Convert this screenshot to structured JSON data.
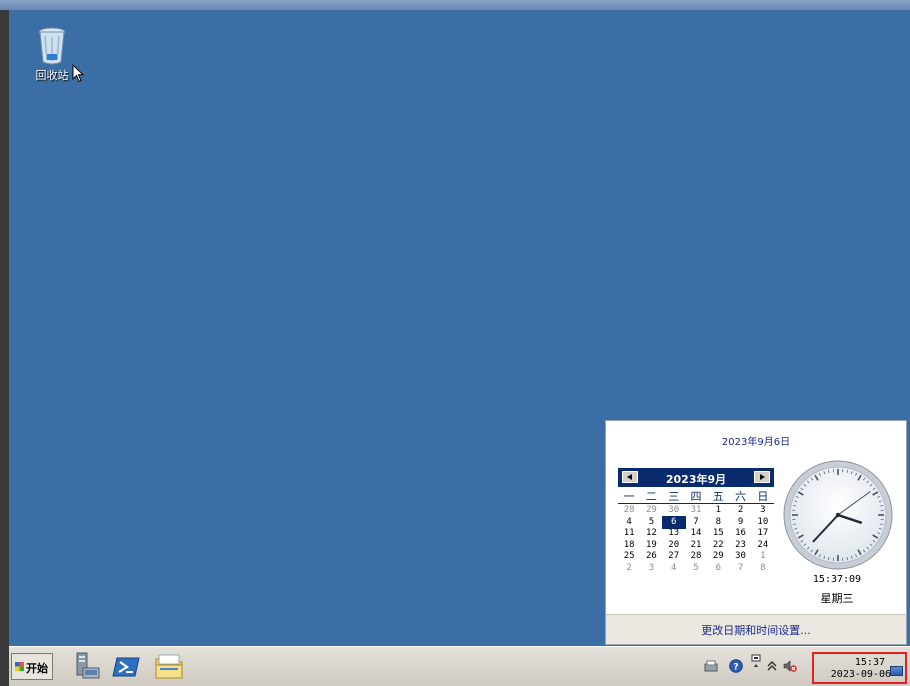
{
  "desktop": {
    "background": "#3a6ea5",
    "recycle_bin_label": "回收站"
  },
  "calendar_popup": {
    "date_title": "2023年9月6日",
    "month_title": "2023年9月",
    "weekdays": [
      "一",
      "二",
      "三",
      "四",
      "五",
      "六",
      "日"
    ],
    "days": [
      {
        "d": "28",
        "dim": true
      },
      {
        "d": "29",
        "dim": true
      },
      {
        "d": "30",
        "dim": true
      },
      {
        "d": "31",
        "dim": true
      },
      {
        "d": "1"
      },
      {
        "d": "2"
      },
      {
        "d": "3"
      },
      {
        "d": "4"
      },
      {
        "d": "5"
      },
      {
        "d": "6",
        "sel": true
      },
      {
        "d": "7"
      },
      {
        "d": "8"
      },
      {
        "d": "9"
      },
      {
        "d": "10"
      },
      {
        "d": "11"
      },
      {
        "d": "12"
      },
      {
        "d": "13"
      },
      {
        "d": "14"
      },
      {
        "d": "15"
      },
      {
        "d": "16"
      },
      {
        "d": "17"
      },
      {
        "d": "18"
      },
      {
        "d": "19"
      },
      {
        "d": "20"
      },
      {
        "d": "21"
      },
      {
        "d": "22"
      },
      {
        "d": "23"
      },
      {
        "d": "24"
      },
      {
        "d": "25"
      },
      {
        "d": "26"
      },
      {
        "d": "27"
      },
      {
        "d": "28"
      },
      {
        "d": "29"
      },
      {
        "d": "30"
      },
      {
        "d": "1",
        "dim": true
      },
      {
        "d": "2",
        "dim": true
      },
      {
        "d": "3",
        "dim": true
      },
      {
        "d": "4",
        "dim": true
      },
      {
        "d": "5",
        "dim": true
      },
      {
        "d": "6",
        "dim": true
      },
      {
        "d": "7",
        "dim": true
      },
      {
        "d": "8",
        "dim": true
      }
    ],
    "time": "15:37:09",
    "weekday_label": "星期三",
    "settings_link": "更改日期和时间设置..."
  },
  "taskbar": {
    "start_label": "开始",
    "clock_time": "15:37",
    "clock_date": "2023-09-06",
    "accent": "#e31f1f"
  }
}
